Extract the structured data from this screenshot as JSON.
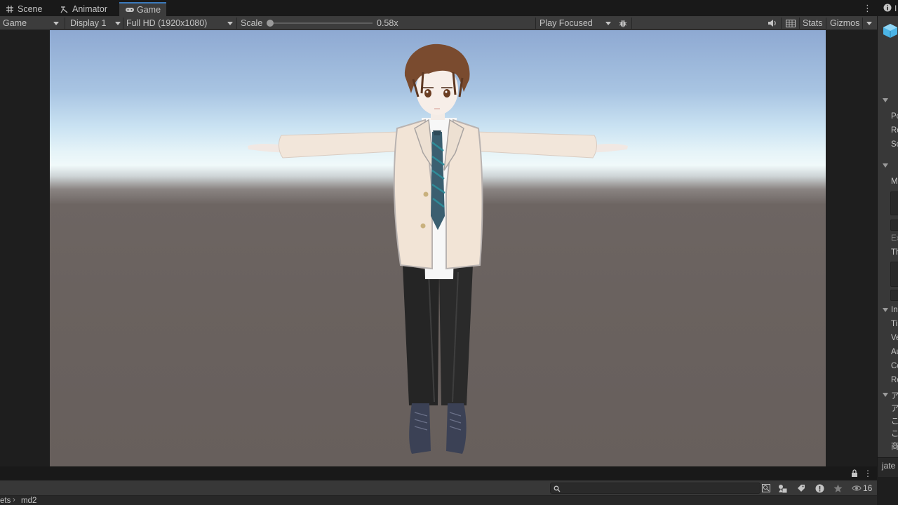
{
  "tabs": [
    {
      "label": "Scene",
      "icon": "grid-icon"
    },
    {
      "label": "Animator",
      "icon": "animator-icon"
    },
    {
      "label": "Game",
      "icon": "gamepad-icon",
      "active": true
    }
  ],
  "toolbar": {
    "view_select": "Game",
    "display": "Display 1",
    "resolution": "Full HD (1920x1080)",
    "scale_label": "Scale",
    "scale_value": "0.58x",
    "play_mode": "Play Focused",
    "stats": "Stats",
    "gizmos": "Gizmos"
  },
  "inspector": {
    "labels": [
      "Po",
      "Ro",
      "Sc",
      "M",
      "Ex",
      "Th",
      "In",
      "Ti",
      "Ve",
      "Au",
      "Co",
      "Re",
      "ア",
      "ア",
      "こ",
      "こ",
      "商"
    ],
    "footer_text": "jate"
  },
  "project": {
    "breadcrumb_prefix": "ets",
    "breadcrumb_folder": "md2",
    "visible_count": "16"
  },
  "colors": {
    "accent": "#3a79bb",
    "panel": "#383838",
    "toolbar": "#3c3c3c",
    "background": "#1e1e1e"
  }
}
